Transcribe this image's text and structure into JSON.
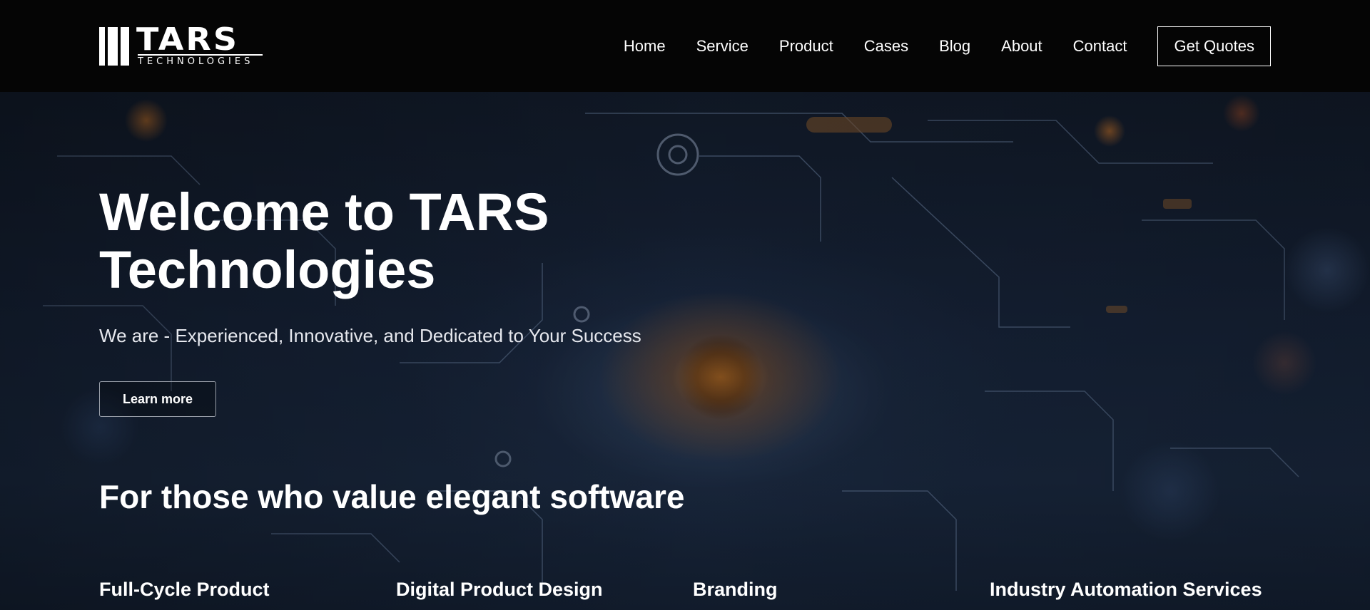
{
  "header": {
    "logo": {
      "wordmark": "TARS",
      "subtext": "TECHNOLOGIES"
    },
    "nav": [
      {
        "label": "Home"
      },
      {
        "label": "Service"
      },
      {
        "label": "Product"
      },
      {
        "label": "Cases"
      },
      {
        "label": "Blog"
      },
      {
        "label": "About"
      },
      {
        "label": "Contact"
      }
    ],
    "cta_label": "Get Quotes"
  },
  "hero": {
    "title": "Welcome to TARS Technologies",
    "subtitle": "We are - Experienced, Innovative, and Dedicated to Your Success",
    "button_label": "Learn more",
    "section_title": "For those who value elegant software",
    "services": [
      {
        "label": "Full-Cycle Product"
      },
      {
        "label": "Digital Product Design"
      },
      {
        "label": "Branding"
      },
      {
        "label": "Industry Automation Services"
      }
    ]
  },
  "colors": {
    "header_bg": "#050505",
    "text": "#ffffff",
    "hero_bg": "#17243a",
    "accent_glow": "#c87828"
  }
}
